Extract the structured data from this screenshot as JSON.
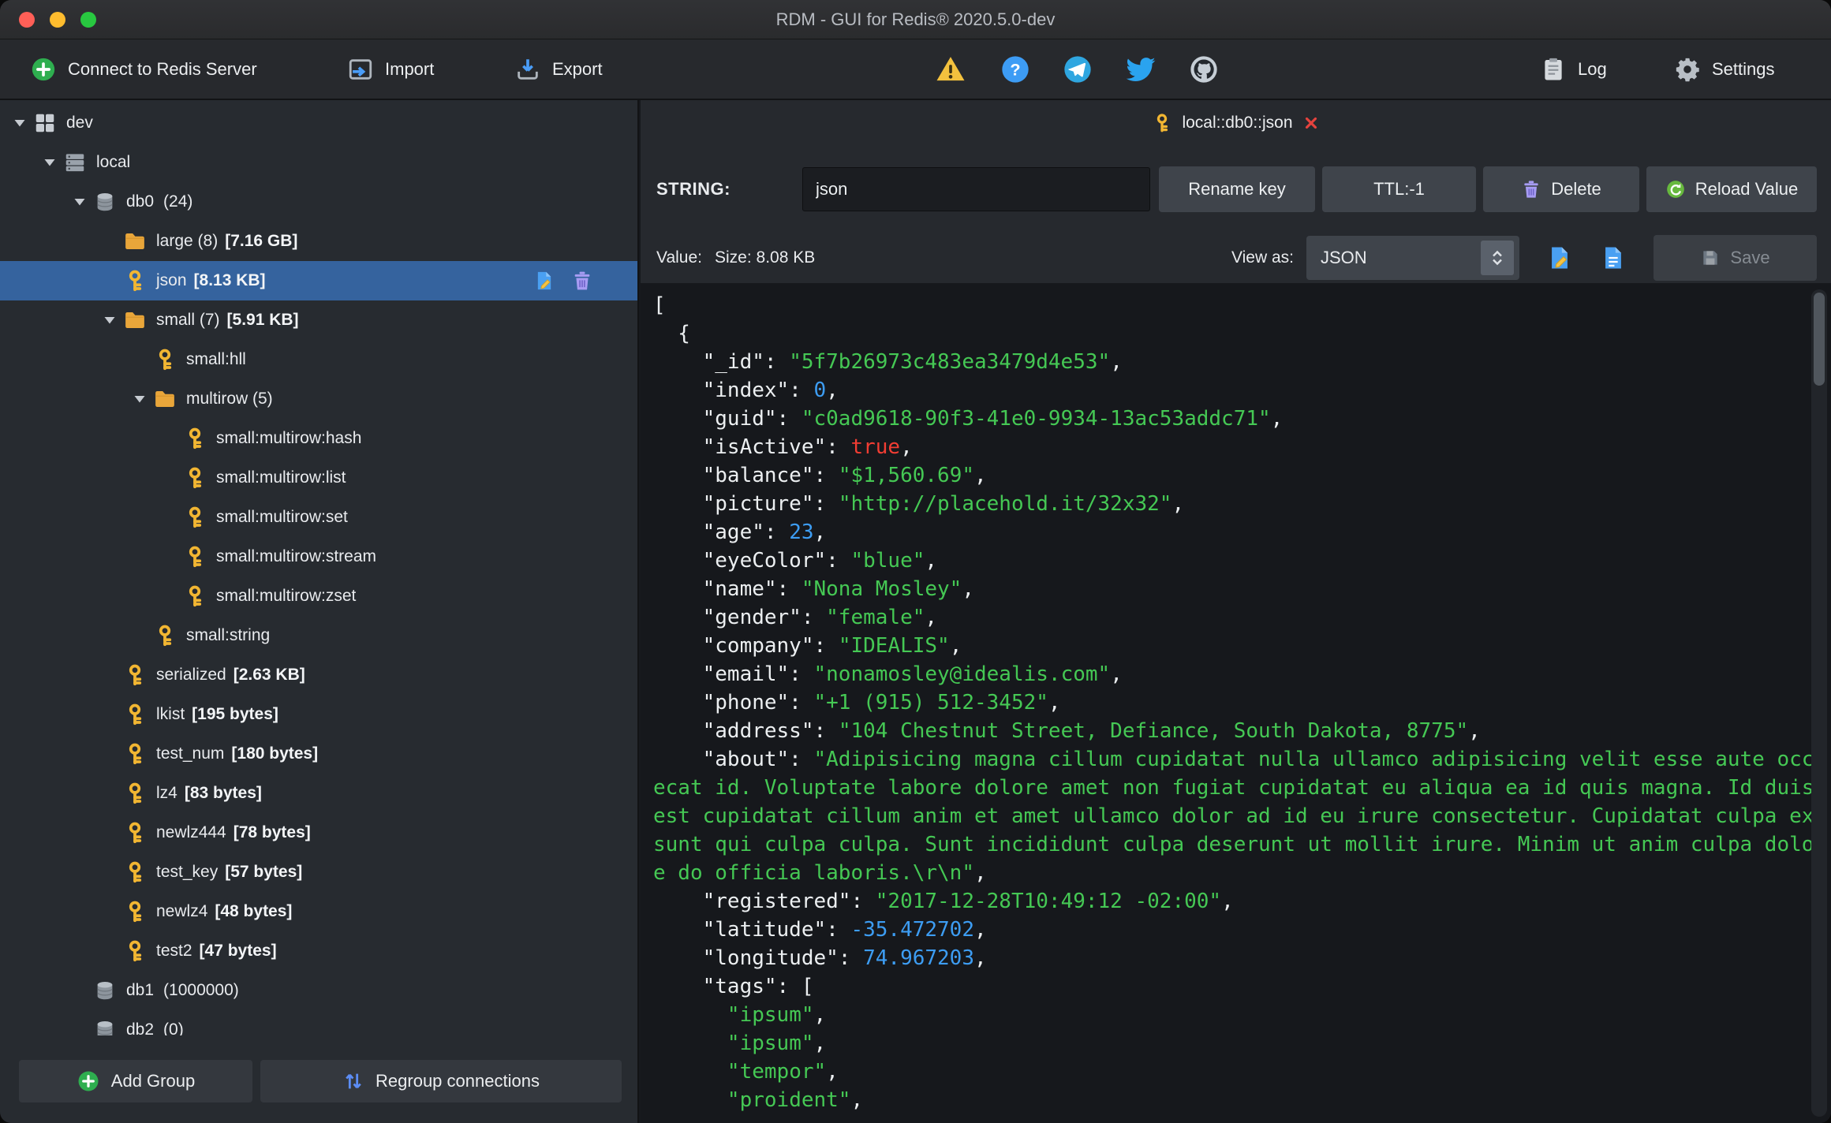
{
  "window": {
    "title": "RDM - GUI for Redis® 2020.5.0-dev"
  },
  "toolbar": {
    "connect_label": "Connect to Redis Server",
    "import_label": "Import",
    "export_label": "Export",
    "log_label": "Log",
    "settings_label": "Settings",
    "status_icons": [
      "warning-icon",
      "help-icon",
      "telegram-icon",
      "twitter-icon",
      "github-icon"
    ]
  },
  "sidebar": {
    "tree": [
      {
        "label": "dev",
        "icon": "connection",
        "level": 0,
        "expanded": true
      },
      {
        "label": "local",
        "icon": "server",
        "level": 1,
        "expanded": true
      },
      {
        "label": "db0",
        "count": "(24)",
        "icon": "database",
        "level": 2,
        "expanded": true
      },
      {
        "label": "large (8)",
        "size": "[7.16 GB]",
        "icon": "folder",
        "level": 3
      },
      {
        "label": "json",
        "size": "[8.13 KB]",
        "icon": "key",
        "level": 3,
        "selected": true,
        "actions": true
      },
      {
        "label": "small (7)",
        "size": "[5.91 KB]",
        "icon": "folder",
        "level": 3,
        "expanded": true
      },
      {
        "label": "small:hll",
        "icon": "key",
        "level": 4
      },
      {
        "label": "multirow (5)",
        "icon": "folder",
        "level": 4,
        "expanded": true
      },
      {
        "label": "small:multirow:hash",
        "icon": "key",
        "level": 5
      },
      {
        "label": "small:multirow:list",
        "icon": "key",
        "level": 5
      },
      {
        "label": "small:multirow:set",
        "icon": "key",
        "level": 5
      },
      {
        "label": "small:multirow:stream",
        "icon": "key",
        "level": 5
      },
      {
        "label": "small:multirow:zset",
        "icon": "key",
        "level": 5
      },
      {
        "label": "small:string",
        "icon": "key",
        "level": 4
      },
      {
        "label": "serialized",
        "size": "[2.63 KB]",
        "icon": "key",
        "level": 3
      },
      {
        "label": "lkist",
        "size": "[195 bytes]",
        "icon": "key",
        "level": 3
      },
      {
        "label": "test_num",
        "size": "[180 bytes]",
        "icon": "key",
        "level": 3
      },
      {
        "label": "lz4",
        "size": "[83 bytes]",
        "icon": "key",
        "level": 3
      },
      {
        "label": "newlz444",
        "size": "[78 bytes]",
        "icon": "key",
        "level": 3
      },
      {
        "label": "test_key",
        "size": "[57 bytes]",
        "icon": "key",
        "level": 3
      },
      {
        "label": "newlz4",
        "size": "[48 bytes]",
        "icon": "key",
        "level": 3
      },
      {
        "label": "test2",
        "size": "[47 bytes]",
        "icon": "key",
        "level": 3
      },
      {
        "label": "db1",
        "count": "(1000000)",
        "icon": "database",
        "level": 2
      },
      {
        "label": "db2",
        "count": "(0)",
        "icon": "database",
        "level": 2
      }
    ],
    "add_group_label": "Add Group",
    "regroup_label": "Regroup connections"
  },
  "main": {
    "tab": {
      "label": "local::db0::json"
    },
    "key_editor": {
      "type_label": "STRING:",
      "key_name": "json",
      "rename_label": "Rename key",
      "ttl_label": "TTL:-1",
      "delete_label": "Delete",
      "reload_label": "Reload Value",
      "value_label": "Value:",
      "size_label": "Size: 8.08 KB",
      "view_as_label": "View as:",
      "view_as_value": "JSON",
      "save_label": "Save"
    },
    "editor": {
      "lines": [
        [
          [
            "p",
            "["
          ]
        ],
        [
          [
            "p",
            "  {"
          ]
        ],
        [
          [
            "p",
            "    \"_id\": "
          ],
          [
            "s",
            "\"5f7b26973c483ea3479d4e53\""
          ],
          [
            "p",
            ","
          ]
        ],
        [
          [
            "p",
            "    \"index\": "
          ],
          [
            "n",
            "0"
          ],
          [
            "p",
            ","
          ]
        ],
        [
          [
            "p",
            "    \"guid\": "
          ],
          [
            "s",
            "\"c0ad9618-90f3-41e0-9934-13ac53addc71\""
          ],
          [
            "p",
            ","
          ]
        ],
        [
          [
            "p",
            "    \"isActive\": "
          ],
          [
            "b",
            "true"
          ],
          [
            "p",
            ","
          ]
        ],
        [
          [
            "p",
            "    \"balance\": "
          ],
          [
            "s",
            "\"$1,560.69\""
          ],
          [
            "p",
            ","
          ]
        ],
        [
          [
            "p",
            "    \"picture\": "
          ],
          [
            "s",
            "\"http://placehold.it/32x32\""
          ],
          [
            "p",
            ","
          ]
        ],
        [
          [
            "p",
            "    \"age\": "
          ],
          [
            "n",
            "23"
          ],
          [
            "p",
            ","
          ]
        ],
        [
          [
            "p",
            "    \"eyeColor\": "
          ],
          [
            "s",
            "\"blue\""
          ],
          [
            "p",
            ","
          ]
        ],
        [
          [
            "p",
            "    \"name\": "
          ],
          [
            "s",
            "\"Nona Mosley\""
          ],
          [
            "p",
            ","
          ]
        ],
        [
          [
            "p",
            "    \"gender\": "
          ],
          [
            "s",
            "\"female\""
          ],
          [
            "p",
            ","
          ]
        ],
        [
          [
            "p",
            "    \"company\": "
          ],
          [
            "s",
            "\"IDEALIS\""
          ],
          [
            "p",
            ","
          ]
        ],
        [
          [
            "p",
            "    \"email\": "
          ],
          [
            "s",
            "\"nonamosley@idealis.com\""
          ],
          [
            "p",
            ","
          ]
        ],
        [
          [
            "p",
            "    \"phone\": "
          ],
          [
            "s",
            "\"+1 (915) 512-3452\""
          ],
          [
            "p",
            ","
          ]
        ],
        [
          [
            "p",
            "    \"address\": "
          ],
          [
            "s",
            "\"104 Chestnut Street, Defiance, South Dakota, 8775\""
          ],
          [
            "p",
            ","
          ]
        ],
        [
          [
            "p",
            "    \"about\": "
          ],
          [
            "s",
            "\"Adipisicing magna cillum cupidatat nulla ullamco adipisicing velit esse aute occa"
          ]
        ],
        [
          [
            "s",
            "ecat id. Voluptate labore dolore amet non fugiat cupidatat eu aliqua ea id quis magna. Id duis "
          ]
        ],
        [
          [
            "s",
            "est cupidatat cillum anim et amet ullamco dolor ad id eu irure consectetur. Cupidatat culpa ex "
          ]
        ],
        [
          [
            "s",
            "sunt qui culpa culpa. Sunt incididunt culpa deserunt ut mollit irure. Minim ut anim culpa dolor"
          ]
        ],
        [
          [
            "s",
            "e do officia laboris.\\r\\n\""
          ],
          [
            "p",
            ","
          ]
        ],
        [
          [
            "p",
            "    \"registered\": "
          ],
          [
            "s",
            "\"2017-12-28T10:49:12 -02:00\""
          ],
          [
            "p",
            ","
          ]
        ],
        [
          [
            "p",
            "    \"latitude\": "
          ],
          [
            "n",
            "-35.472702"
          ],
          [
            "p",
            ","
          ]
        ],
        [
          [
            "p",
            "    \"longitude\": "
          ],
          [
            "n",
            "74.967203"
          ],
          [
            "p",
            ","
          ]
        ],
        [
          [
            "p",
            "    \"tags\": ["
          ]
        ],
        [
          [
            "p",
            "      "
          ],
          [
            "s",
            "\"ipsum\""
          ],
          [
            "p",
            ","
          ]
        ],
        [
          [
            "p",
            "      "
          ],
          [
            "s",
            "\"ipsum\""
          ],
          [
            "p",
            ","
          ]
        ],
        [
          [
            "p",
            "      "
          ],
          [
            "s",
            "\"tempor\""
          ],
          [
            "p",
            ","
          ]
        ],
        [
          [
            "p",
            "      "
          ],
          [
            "s",
            "\"proident\""
          ],
          [
            "p",
            ","
          ]
        ]
      ]
    }
  },
  "colors": {
    "selection_blue": "#35639e",
    "string_green": "#45c854",
    "number_blue": "#3d9df3",
    "bool_red": "#f23d33",
    "key_gold": "#f2b632"
  }
}
